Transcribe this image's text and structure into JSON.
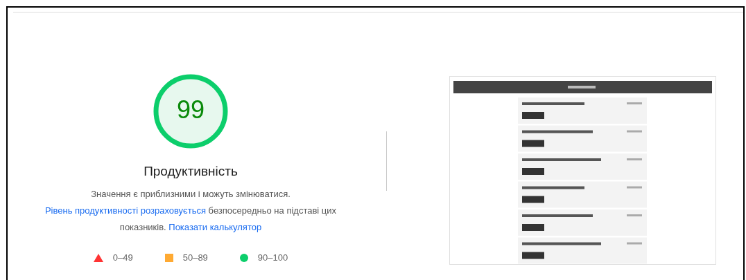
{
  "gauge": {
    "score": "99",
    "title": "Продуктивність"
  },
  "description": [
    {
      "kind": "text",
      "text": "Значення є приблизними і можуть змінюватися. "
    },
    {
      "kind": "link",
      "text": "Рівень продуктивності розраховується"
    },
    {
      "kind": "text",
      "text": " безпосередньо на підставі цих показників. "
    },
    {
      "kind": "link",
      "text": "Показати калькулятор"
    }
  ],
  "legend": [
    {
      "kind": "triangle",
      "color": "#ff3333",
      "label": "0–49"
    },
    {
      "kind": "square",
      "color": "#ffaa33",
      "label": "50–89"
    },
    {
      "kind": "circle",
      "color": "#0cce6b",
      "label": "90–100"
    }
  ]
}
